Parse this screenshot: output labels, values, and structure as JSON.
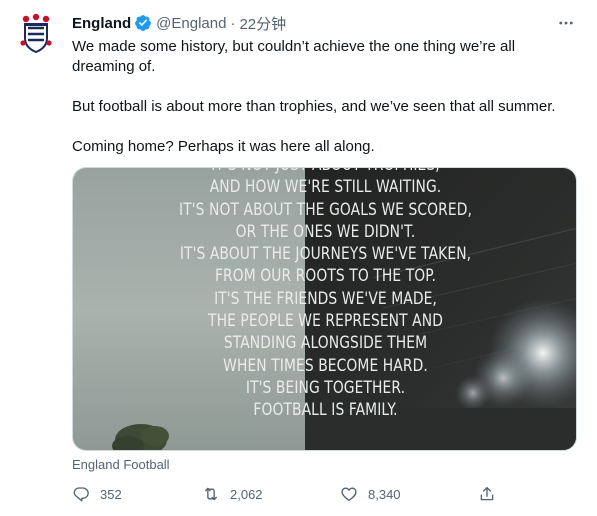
{
  "author": {
    "name": "England",
    "handle": "@England",
    "time": "22分钟",
    "separator": "·"
  },
  "tweet": {
    "lines": [
      "We made some history, but couldn’t achieve the one thing we’re all dreaming of.",
      "But football is about more than trophies, and we’ve seen that all summer.",
      "Coming home? Perhaps it was here all along."
    ]
  },
  "media": {
    "text_lines": [
      "IT'S NOT JUST ABOUT TROPHIES,",
      "AND HOW WE'RE STILL WAITING.",
      "IT'S NOT ABOUT THE GOALS WE SCORED,",
      "OR THE ONES WE DIDN'T.",
      "IT'S ABOUT THE JOURNEYS WE'VE TAKEN,",
      "FROM OUR  ROOTS TO THE TOP.",
      "IT'S THE FRIENDS WE'VE MADE,",
      "THE PEOPLE WE REPRESENT AND",
      "STANDING ALONGSIDE THEM",
      "WHEN TIMES BECOME HARD.",
      "IT'S BEING TOGETHER.",
      "FOOTBALL IS FAMILY."
    ]
  },
  "source": "England Football",
  "actions": {
    "replies": "352",
    "retweets": "2,062",
    "likes": "8,340"
  },
  "icons": {
    "avatar": "three-lions-crest-icon",
    "verified": "verified-badge-icon",
    "more": "more-options-icon",
    "reply": "reply-icon",
    "retweet": "retweet-icon",
    "like": "heart-icon",
    "share": "share-icon"
  },
  "colors": {
    "verified": "#1d9bf0",
    "text_primary": "#0f1419",
    "text_secondary": "#536471",
    "crest_red": "#c8102e",
    "crest_blue": "#1b2a5c"
  }
}
